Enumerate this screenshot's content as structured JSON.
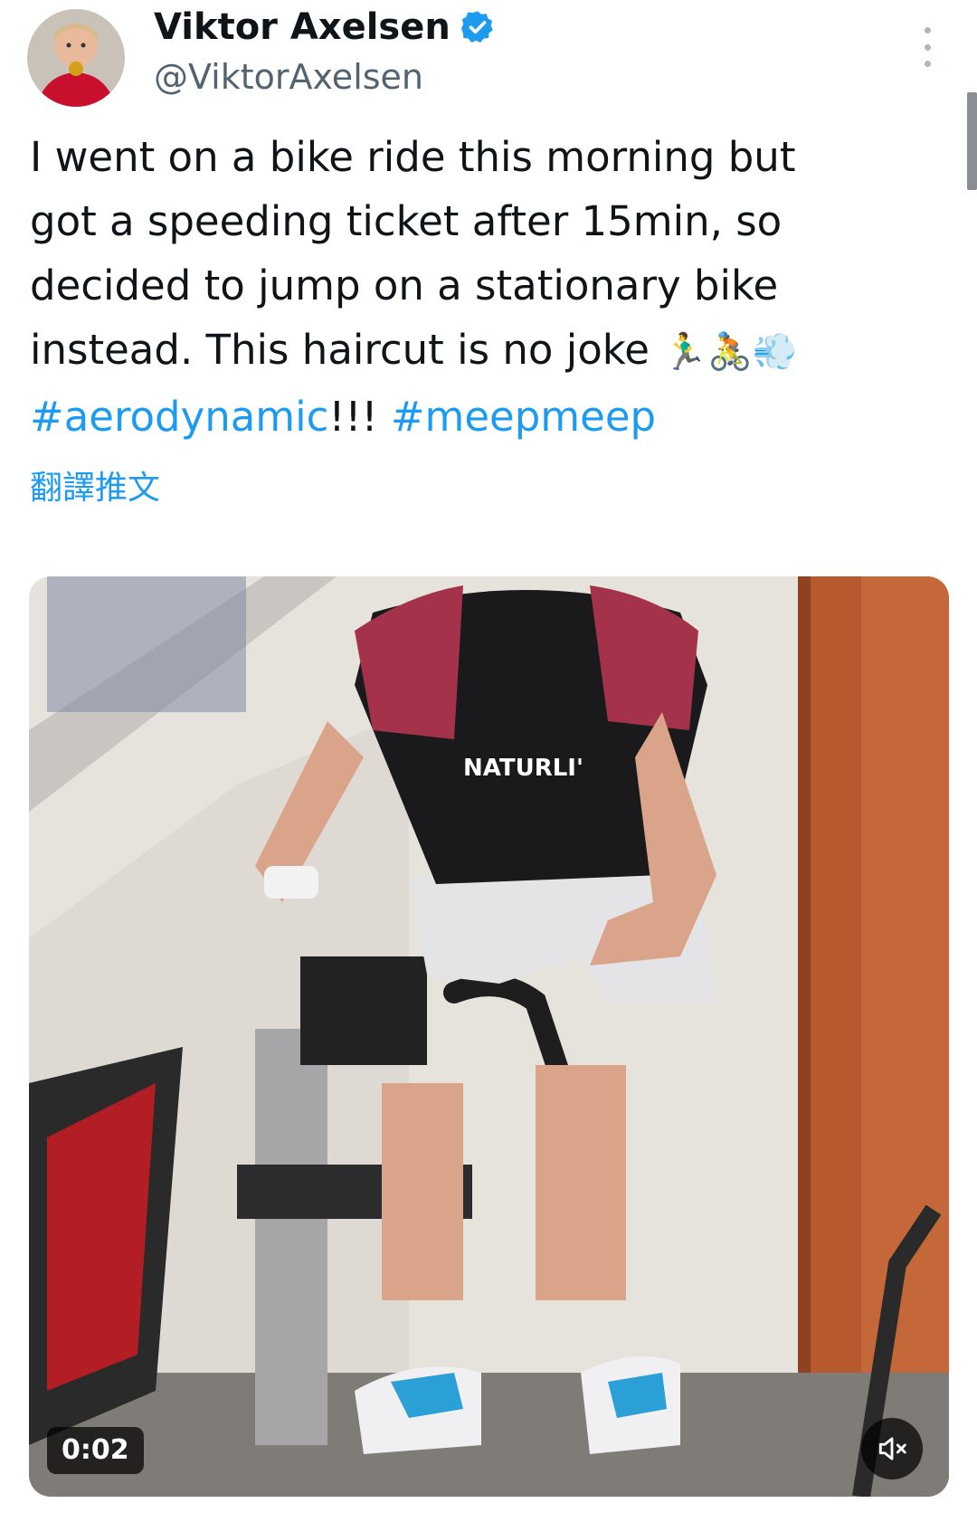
{
  "author": {
    "name": "Viktor Axelsen",
    "handle": "@ViktorAxelsen",
    "verified": true,
    "avatar_icon": "avatar-photo"
  },
  "tweet": {
    "lines": [
      "I went on a bike ride this morning but",
      "got a speeding ticket after 15min, so",
      "decided to jump on a stationary bike",
      "instead. This haircut is no joke"
    ],
    "emojis": "🏃‍♂️🚴💨",
    "hashtag_1": "#aerodynamic",
    "exclaim": "!!! ",
    "hashtag_2": "#meepmeep"
  },
  "translate_label": "翻譯推文",
  "video": {
    "timestamp": "0:02",
    "muted": true,
    "shirt_text": "NATURLI'",
    "scrollbar_icon": "scrollbar"
  },
  "colors": {
    "link": "#1d9bf0",
    "text": "#0f1419",
    "secondary": "#536471"
  }
}
